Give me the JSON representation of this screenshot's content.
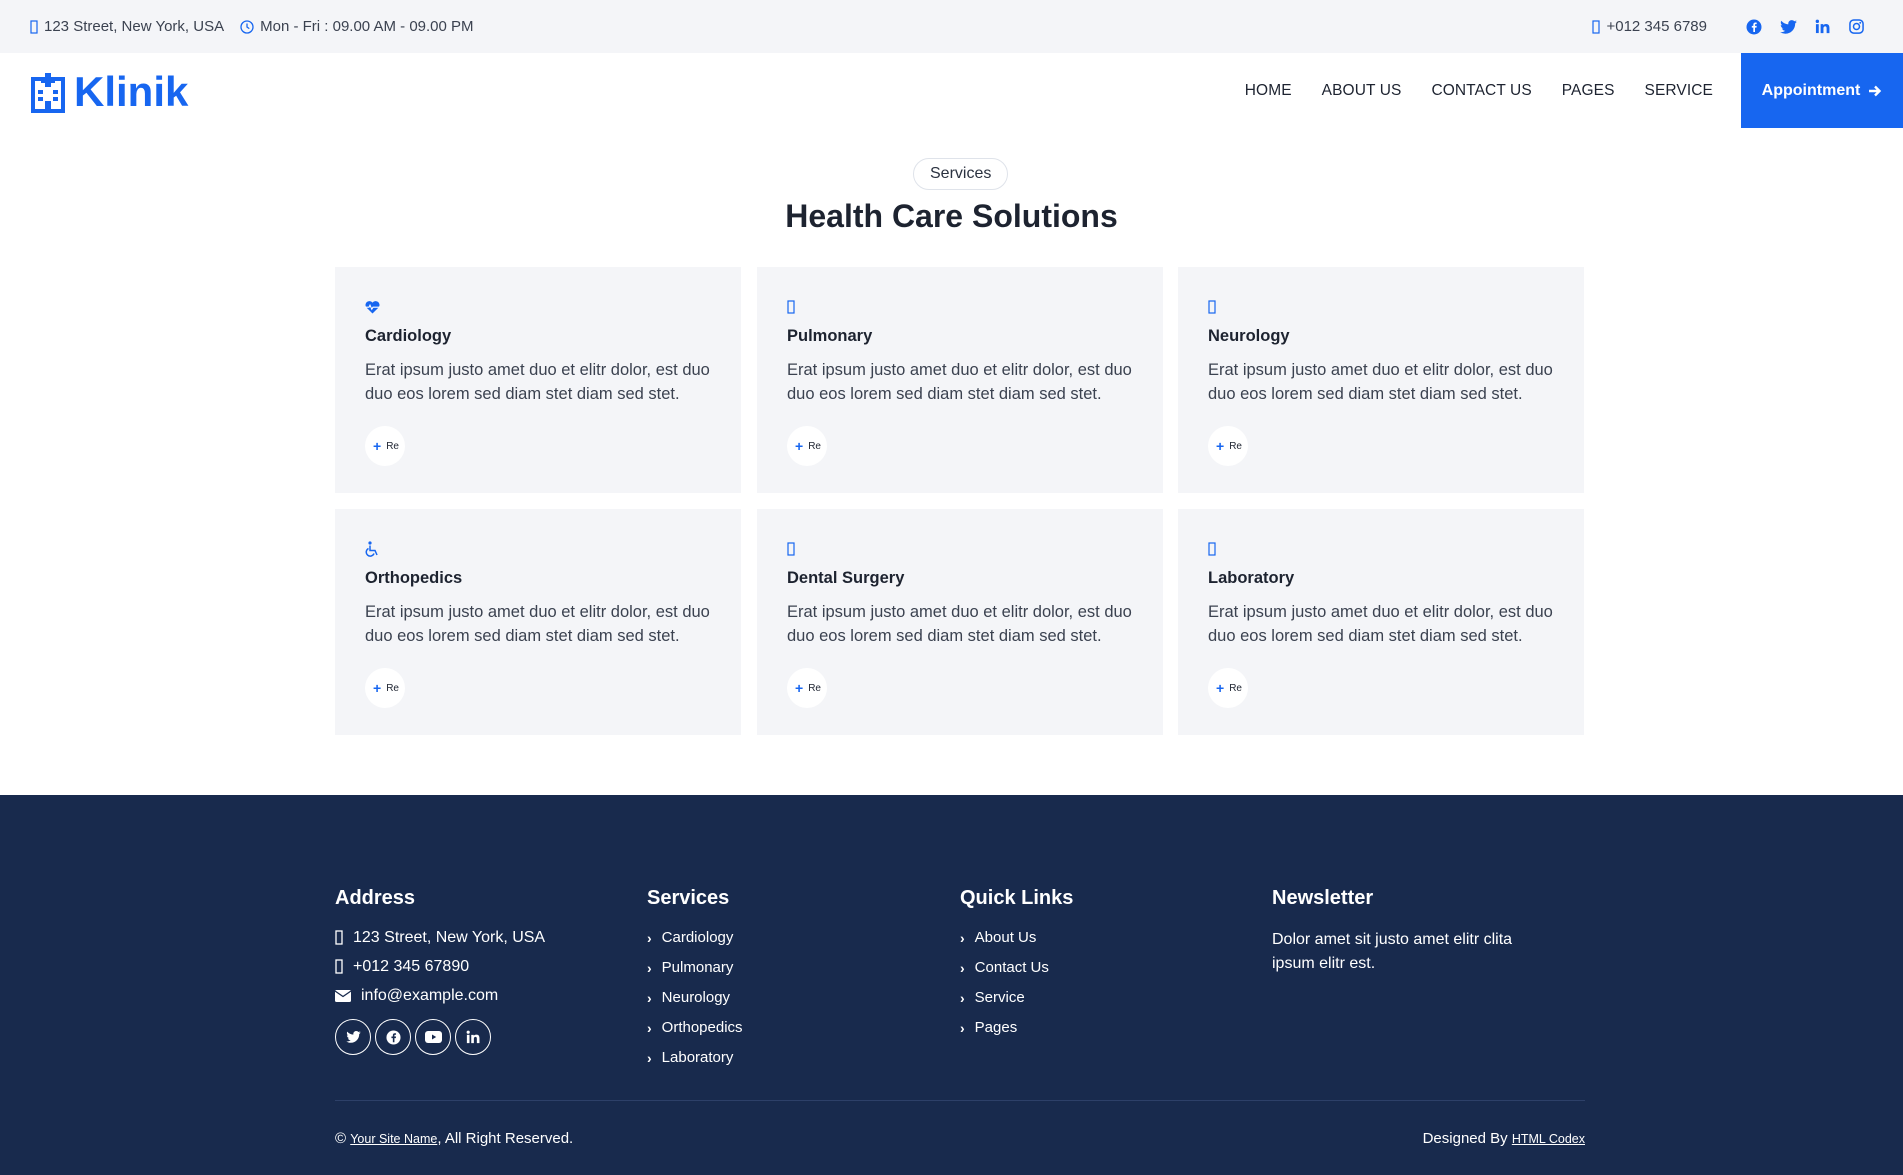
{
  "topbar": {
    "address": "123 Street, New York, USA",
    "hours": "Mon - Fri : 09.00 AM - 09.00 PM",
    "phone": "+012 345 6789",
    "social": [
      "facebook-icon",
      "twitter-icon",
      "linkedin-icon",
      "instagram-icon"
    ]
  },
  "brand": {
    "name": "Klinik"
  },
  "nav": {
    "items": [
      "HOME",
      "ABOUT US",
      "CONTACT US",
      "PAGES",
      "SERVICE"
    ],
    "appointment": "Appointment"
  },
  "services": {
    "badge": "Services",
    "title": "Health Care Solutions",
    "readmore": "Re",
    "cards": [
      {
        "title": "Cardiology",
        "icon": "heart-pulse-icon",
        "text": "Erat ipsum justo amet duo et elitr dolor, est duo duo eos lorem sed diam stet diam sed stet."
      },
      {
        "title": "Pulmonary",
        "icon": "lungs-icon",
        "text": "Erat ipsum justo amet duo et elitr dolor, est duo duo eos lorem sed diam stet diam sed stet."
      },
      {
        "title": "Neurology",
        "icon": "brain-icon",
        "text": "Erat ipsum justo amet duo et elitr dolor, est duo duo eos lorem sed diam stet diam sed stet."
      },
      {
        "title": "Orthopedics",
        "icon": "wheelchair-icon",
        "text": "Erat ipsum justo amet duo et elitr dolor, est duo duo eos lorem sed diam stet diam sed stet."
      },
      {
        "title": "Dental Surgery",
        "icon": "tooth-icon",
        "text": "Erat ipsum justo amet duo et elitr dolor, est duo duo eos lorem sed diam stet diam sed stet."
      },
      {
        "title": "Laboratory",
        "icon": "vial-icon",
        "text": "Erat ipsum justo amet duo et elitr dolor, est duo duo eos lorem sed diam stet diam sed stet."
      }
    ]
  },
  "footer": {
    "address": {
      "heading": "Address",
      "street": "123 Street, New York, USA",
      "phone": "+012 345 67890",
      "email": "info@example.com",
      "social": [
        "twitter-icon",
        "facebook-icon",
        "youtube-icon",
        "linkedin-icon"
      ]
    },
    "services": {
      "heading": "Services",
      "items": [
        "Cardiology",
        "Pulmonary",
        "Neurology",
        "Orthopedics",
        "Laboratory"
      ]
    },
    "quicklinks": {
      "heading": "Quick Links",
      "items": [
        "About Us",
        "Contact Us",
        "Service",
        "Pages"
      ]
    },
    "newsletter": {
      "heading": "Newsletter",
      "text": "Dolor amet sit justo amet elitr clita ipsum elitr est."
    },
    "copyright_prefix": "©",
    "site_name": "Your Site Name",
    "copyright_suffix": ", All Right Reserved.",
    "designed_prefix": "Designed By",
    "designer": "HTML Codex"
  },
  "colors": {
    "accent": "#1766f0",
    "footer_bg": "#182a4d",
    "card_bg": "#f4f5f8",
    "topbar_bg": "#f4f5f8"
  }
}
